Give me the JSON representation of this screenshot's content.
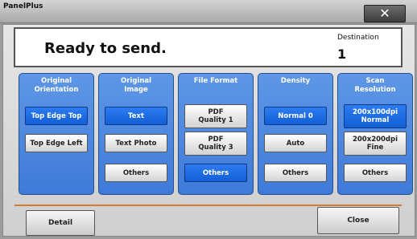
{
  "window": {
    "title": "PanelPlus",
    "close_glyph": "✕"
  },
  "status": {
    "message": "Ready to send.",
    "destination_label": "Destination",
    "destination_value": "1"
  },
  "columns": [
    {
      "header": "Original\nOrientation",
      "buttons": [
        {
          "label": "Top Edge Top",
          "selected": true
        },
        {
          "label": "Top Edge Left",
          "selected": false
        }
      ]
    },
    {
      "header": "Original\nImage",
      "buttons": [
        {
          "label": "Text",
          "selected": true
        },
        {
          "label": "Text Photo",
          "selected": false
        },
        {
          "label": "Others",
          "selected": false
        }
      ]
    },
    {
      "header": "File Format",
      "buttons": [
        {
          "label": "PDF\nQuality 1",
          "selected": false
        },
        {
          "label": "PDF\nQuality 3",
          "selected": false
        },
        {
          "label": "Others",
          "selected": true
        }
      ]
    },
    {
      "header": "Density",
      "buttons": [
        {
          "label": "Normal 0",
          "selected": true
        },
        {
          "label": "Auto",
          "selected": false
        },
        {
          "label": "Others",
          "selected": false
        }
      ]
    },
    {
      "header": "Scan\nResolution",
      "buttons": [
        {
          "label": "200x100dpi\nNormal",
          "selected": true
        },
        {
          "label": "200x200dpi\nFine",
          "selected": false
        },
        {
          "label": "Others",
          "selected": false
        }
      ]
    }
  ],
  "footer": {
    "detail_label": "Detail",
    "close_label": "Close"
  },
  "colors": {
    "accent_blue": "#3f7ad9",
    "selected_blue": "#1a66e0",
    "divider_orange": "#d47b33"
  }
}
